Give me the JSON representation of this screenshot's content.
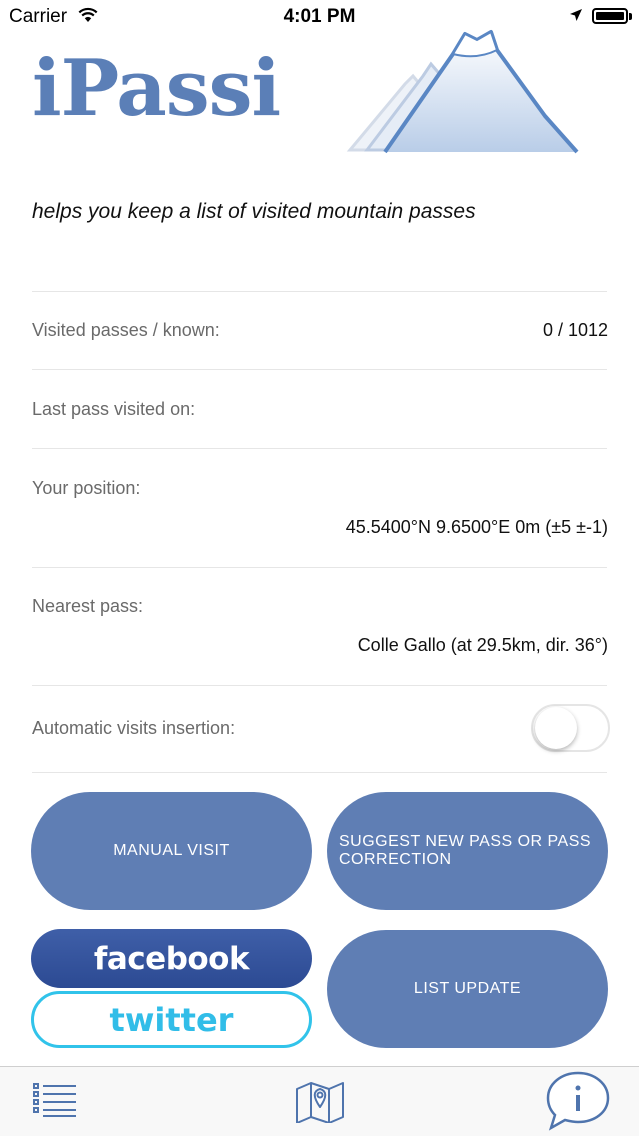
{
  "status_bar": {
    "carrier": "Carrier",
    "time": "4:01 PM"
  },
  "header": {
    "app_name": "iPassi",
    "tagline": "helps you keep a list of visited mountain passes"
  },
  "rows": {
    "visited": {
      "label": "Visited passes / known:",
      "value": "0 / 1012"
    },
    "last_visit": {
      "label": "Last pass visited on:",
      "value": ""
    },
    "position": {
      "label": "Your position:",
      "value": "45.5400°N 9.6500°E 0m (±5 ±-1)"
    },
    "nearest": {
      "label": "Nearest pass:",
      "value": "Colle Gallo (at 29.5km, dir. 36°)"
    },
    "auto_insert": {
      "label": "Automatic visits insertion:",
      "enabled": false
    }
  },
  "buttons": {
    "manual_visit": "MANUAL VISIT",
    "suggest": "SUGGEST NEW PASS OR PASS CORRECTION",
    "facebook": "facebook",
    "twitter": "twitter",
    "list_update": "LIST UPDATE"
  },
  "tab_bar": {
    "icons": [
      "list-icon",
      "map-icon",
      "info-icon"
    ]
  },
  "colors": {
    "accent": "#5f7eb4",
    "logo": "#5b7fb7",
    "facebook": "#3b5998",
    "twitter": "#31c3ea",
    "tab_icon": "#4f74ad"
  }
}
